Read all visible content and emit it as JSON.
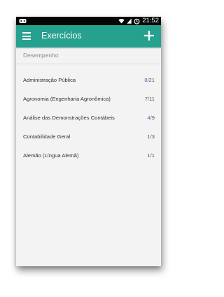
{
  "status_bar": {
    "time": "21:52",
    "icons": [
      "android-icon",
      "wifi-icon",
      "signal-icon",
      "alarm-icon"
    ]
  },
  "app_bar": {
    "title": "Exercícios",
    "menu_icon": "hamburger-menu-icon",
    "action_icon": "add-icon"
  },
  "section": {
    "title": "Desempenho"
  },
  "items": [
    {
      "label": "Administração Pública",
      "done": "8",
      "total": "21"
    },
    {
      "label": "Agronomia (Engenharia Agronômica)",
      "done": "7",
      "total": "11"
    },
    {
      "label": "Análise das Demonstrações Contábeis",
      "done": "4",
      "total": "9"
    },
    {
      "label": "Contabilidade Geral",
      "done": "1",
      "total": "3"
    },
    {
      "label": "Alemão (Língua Alemã)",
      "done": "1",
      "total": "1"
    }
  ],
  "colors": {
    "app_bar": "#26a08f",
    "status_bar": "#050505",
    "done_count": "#7a4fc8",
    "background": "#f3f3f3"
  }
}
